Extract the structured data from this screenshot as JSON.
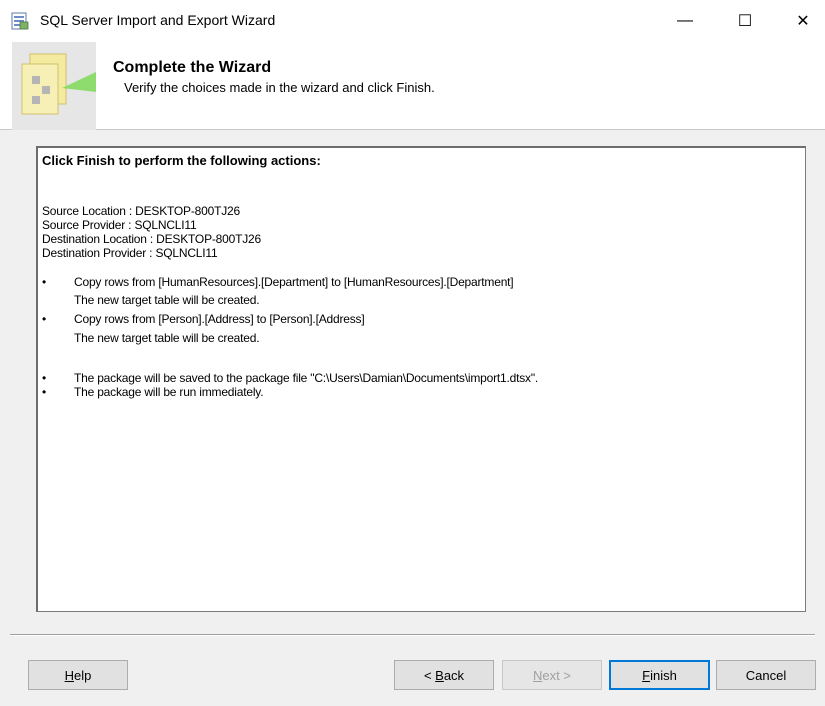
{
  "window": {
    "title": "SQL Server Import and Export Wizard",
    "minimize_glyph": "—",
    "maximize_glyph": "☐",
    "close_glyph": "✕"
  },
  "header": {
    "title": "Complete the Wizard",
    "subtitle": "Verify the choices made in the wizard and click Finish."
  },
  "summary": {
    "heading": "Click Finish to perform the following actions:",
    "lines": [
      "Source Location : DESKTOP-800TJ26",
      "Source Provider : SQLNCLI11",
      "Destination Location : DESKTOP-800TJ26",
      "Destination Provider : SQLNCLI11"
    ],
    "bullets": [
      "Copy rows from [HumanResources].[Department] to [HumanResources].[Department]",
      "The new target table will be created.",
      "Copy rows from [Person].[Address] to [Person].[Address]",
      "The new target table will be created.",
      "The package will be saved to the package file \"C:\\Users\\Damian\\Documents\\import1.dtsx\".",
      "The package will be run immediately."
    ],
    "bullet_glyph": "•"
  },
  "buttons": {
    "help": {
      "mnemonic": "H",
      "rest": "elp"
    },
    "back": {
      "prefix": "< ",
      "mnemonic": "B",
      "rest": "ack"
    },
    "next": {
      "mnemonic": "N",
      "rest": "ext >"
    },
    "finish": {
      "mnemonic": "F",
      "rest": "inish"
    },
    "cancel": "Cancel"
  },
  "colors": {
    "focus_border": "#0078d7",
    "disabled_text": "#a0a0a0"
  }
}
